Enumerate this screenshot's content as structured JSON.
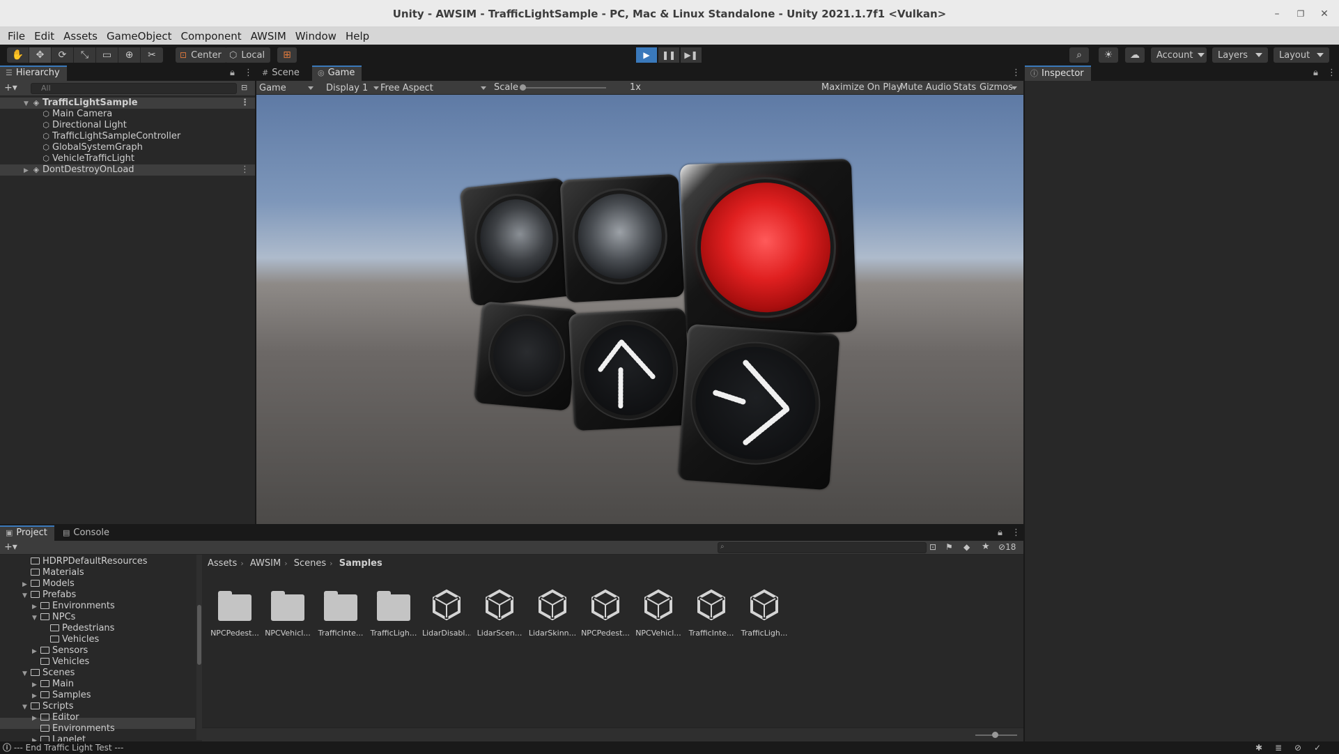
{
  "window": {
    "title": "Unity - AWSIM - TrafficLightSample - PC, Mac & Linux Standalone - Unity 2021.1.7f1 <Vulkan>"
  },
  "menu": [
    "File",
    "Edit",
    "Assets",
    "GameObject",
    "Component",
    "AWSIM",
    "Window",
    "Help"
  ],
  "toolbar": {
    "tools": [
      "hand-icon",
      "move-icon",
      "rotate-icon",
      "scale-icon",
      "rect-icon",
      "transform-icon",
      "custom-tool-icon"
    ],
    "pivot": "Center",
    "space": "Local",
    "account": "Account",
    "layers": "Layers",
    "layout": "Layout"
  },
  "hierarchy": {
    "tab": "Hierarchy",
    "search_placeholder": "All",
    "items": [
      {
        "label": "TrafficLightSample",
        "level": 0
      },
      {
        "label": "Main Camera",
        "level": 1
      },
      {
        "label": "Directional Light",
        "level": 1
      },
      {
        "label": "TrafficLightSampleController",
        "level": 1
      },
      {
        "label": "GlobalSystemGraph",
        "level": 1
      },
      {
        "label": "VehicleTrafficLight",
        "level": 1
      },
      {
        "label": "DontDestroyOnLoad",
        "level": 0
      }
    ]
  },
  "game": {
    "tabs": [
      "Scene",
      "Game"
    ],
    "mode": "Game",
    "display": "Display 1",
    "aspect": "Free Aspect",
    "scale_label": "Scale",
    "scale_value": "1x",
    "maximize": "Maximize On Play",
    "mute": "Mute Audio",
    "stats": "Stats",
    "gizmos": "Gizmos",
    "lights": {
      "top": [
        "off",
        "off",
        "red"
      ],
      "bottom": [
        "left-arrow-off",
        "up-arrow",
        "right-arrow"
      ]
    }
  },
  "inspector": {
    "tab": "Inspector"
  },
  "project": {
    "tabs": [
      "Project",
      "Console"
    ],
    "hidden_count": "18",
    "tree": [
      {
        "label": "HDRPDefaultResources",
        "level": 1,
        "arrow": ""
      },
      {
        "label": "Materials",
        "level": 1,
        "arrow": ""
      },
      {
        "label": "Models",
        "level": 1,
        "arrow": "▶"
      },
      {
        "label": "Prefabs",
        "level": 1,
        "arrow": "▼"
      },
      {
        "label": "Environments",
        "level": 2,
        "arrow": "▶"
      },
      {
        "label": "NPCs",
        "level": 2,
        "arrow": "▼"
      },
      {
        "label": "Pedestrians",
        "level": 3,
        "arrow": ""
      },
      {
        "label": "Vehicles",
        "level": 3,
        "arrow": ""
      },
      {
        "label": "Sensors",
        "level": 2,
        "arrow": "▶"
      },
      {
        "label": "Vehicles",
        "level": 2,
        "arrow": ""
      },
      {
        "label": "Scenes",
        "level": 1,
        "arrow": "▼"
      },
      {
        "label": "Main",
        "level": 2,
        "arrow": "▶"
      },
      {
        "label": "Samples",
        "level": 2,
        "arrow": "▶"
      },
      {
        "label": "Scripts",
        "level": 1,
        "arrow": "▼"
      },
      {
        "label": "Editor",
        "level": 2,
        "arrow": "▶"
      },
      {
        "label": "Environments",
        "level": 2,
        "arrow": ""
      },
      {
        "label": "Lanelet",
        "level": 2,
        "arrow": "▶"
      }
    ],
    "breadcrumb": [
      "Assets",
      "AWSIM",
      "Scenes",
      "Samples"
    ],
    "assets": [
      {
        "label": "NPCPedest...",
        "kind": "folder"
      },
      {
        "label": "NPCVehicl...",
        "kind": "folder"
      },
      {
        "label": "TrafficInte...",
        "kind": "folder"
      },
      {
        "label": "TrafficLigh...",
        "kind": "folder"
      },
      {
        "label": "LidarDisabl...",
        "kind": "scene"
      },
      {
        "label": "LidarScen...",
        "kind": "scene"
      },
      {
        "label": "LidarSkinn...",
        "kind": "scene"
      },
      {
        "label": "NPCPedest...",
        "kind": "scene"
      },
      {
        "label": "NPCVehicl...",
        "kind": "scene"
      },
      {
        "label": "TrafficInte...",
        "kind": "scene"
      },
      {
        "label": "TrafficLigh...",
        "kind": "scene"
      }
    ]
  },
  "status": {
    "message": "--- End Traffic Light Test ---"
  },
  "colors": {
    "accent": "#3a79bb",
    "red_light": "#e02020",
    "bg": "#282828"
  }
}
